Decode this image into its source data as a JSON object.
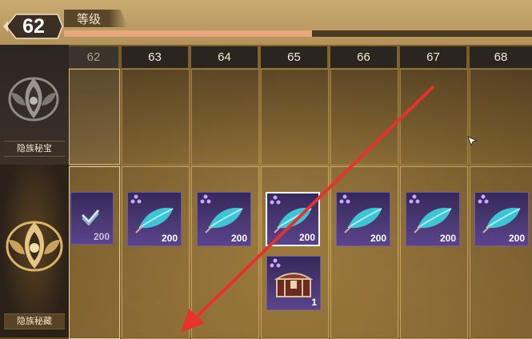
{
  "player": {
    "level": "62",
    "level_label": "等级",
    "level_progress": 0.53
  },
  "sidebar": {
    "sections": [
      {
        "label": "隐族秘宝"
      },
      {
        "label": "隐族秘藏"
      }
    ]
  },
  "columns": [
    "62",
    "63",
    "64",
    "65",
    "66",
    "67",
    "68"
  ],
  "rewards": {
    "first_column_item": {
      "count": "200"
    },
    "secret_row": [
      {
        "level": "63",
        "count": "200",
        "icon": "teal-feather-fish-icon"
      },
      {
        "level": "64",
        "count": "200",
        "icon": "teal-feather-fish-icon"
      },
      {
        "level": "65",
        "count": "200",
        "icon": "teal-feather-fish-icon",
        "selected": true
      },
      {
        "level": "66",
        "count": "200",
        "icon": "teal-feather-fish-icon"
      },
      {
        "level": "67",
        "count": "200",
        "icon": "teal-feather-fish-icon"
      },
      {
        "level": "68",
        "count": "200",
        "icon": "teal-feather-fish-icon"
      }
    ],
    "extra_item": {
      "level": "65",
      "count": "1",
      "icon": "treasure-chest-icon"
    }
  },
  "colors": {
    "accent_red": "#e5322d",
    "item_purple": "#4a3873",
    "teal": "#3fc4d6"
  }
}
